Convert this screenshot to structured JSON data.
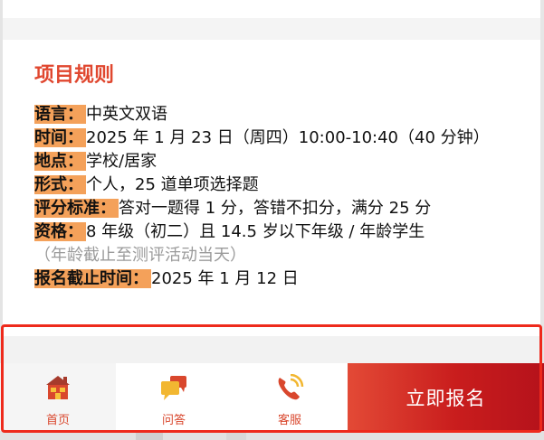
{
  "rules": {
    "title": "项目规则",
    "items": [
      {
        "label": "语言：",
        "value": "中英文双语"
      },
      {
        "label": "时间：",
        "value": "2025 年 1 月 23 日（周四）10:00-10:40（40 分钟）"
      },
      {
        "label": "地点：",
        "value": "学校/居家"
      },
      {
        "label": "形式：",
        "value": "个人，25 道单项选择题"
      },
      {
        "label": "评分标准：",
        "value": "答对一题得 1 分，答错不扣分，满分 25 分"
      },
      {
        "label": "资格：",
        "value": "8 年级（初二）且 14.5 岁以下年级 / 年龄学生"
      },
      {
        "label": "报名截止时间：",
        "value": "2025 年 1 月 12 日"
      }
    ],
    "eligibility_note": "（年龄截止至测评活动当天）"
  },
  "tabbar": {
    "home_label": "首页",
    "qa_label": "问答",
    "service_label": "客服",
    "signup_label": "立即报名"
  },
  "colors": {
    "accent_red": "#e0472f",
    "label_highlight": "#f4a15a",
    "signup_gradient_start": "#e34a36",
    "signup_gradient_end": "#b5121b"
  },
  "icons": {
    "home": "house-icon",
    "qa": "chat-bubbles-icon",
    "service": "phone-icon"
  }
}
